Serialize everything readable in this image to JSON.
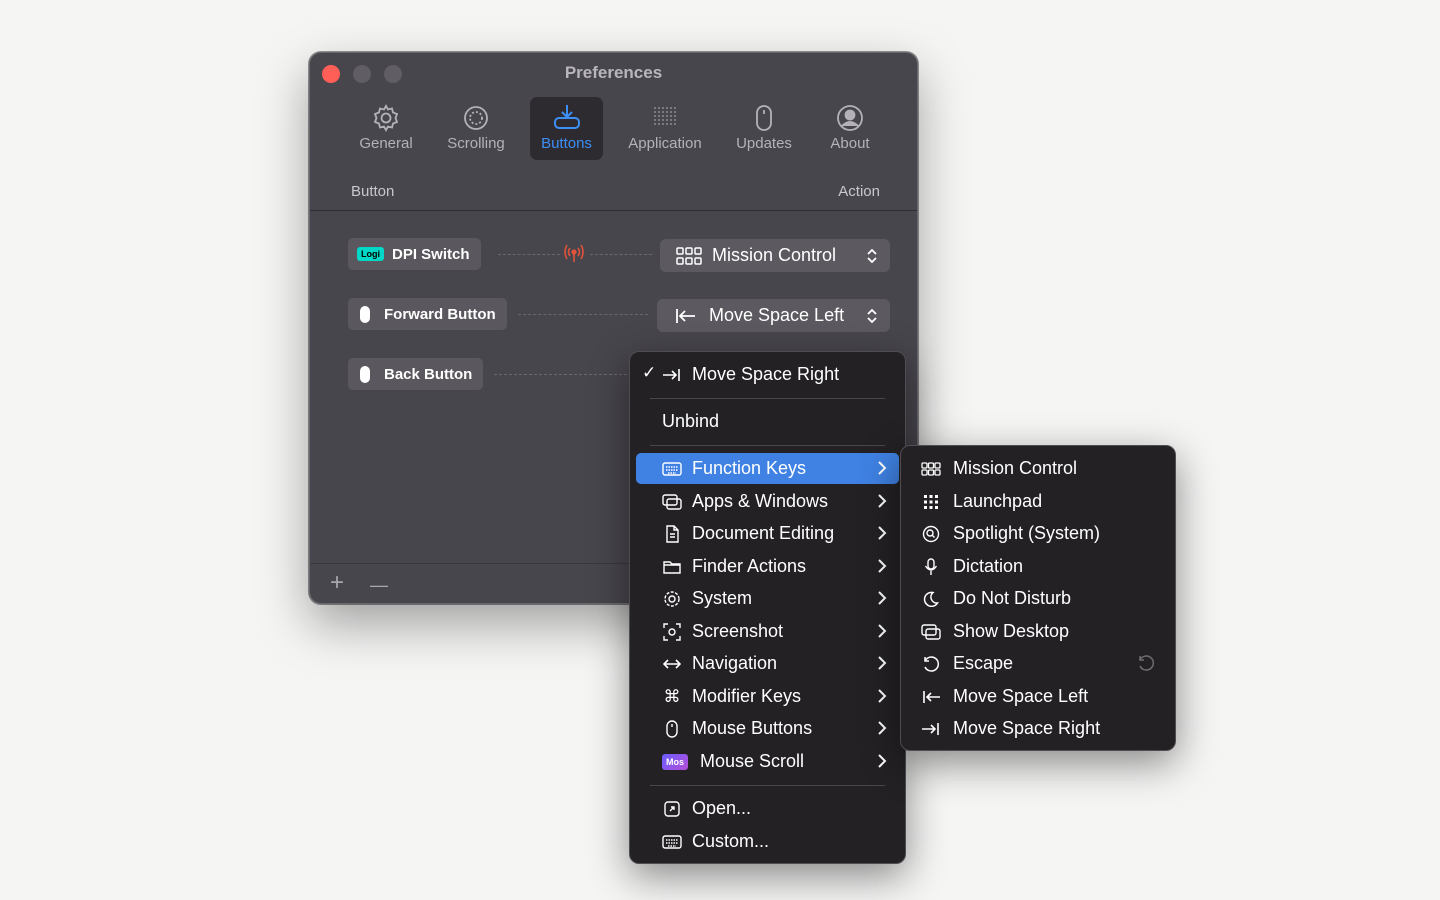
{
  "window": {
    "title": "Preferences"
  },
  "tabs": [
    {
      "label": "General",
      "icon": "gear-icon"
    },
    {
      "label": "Scrolling",
      "icon": "scroll-circle-icon"
    },
    {
      "label": "Buttons",
      "icon": "tray-download-icon",
      "active": true
    },
    {
      "label": "Application",
      "icon": "dot-grid-icon"
    },
    {
      "label": "Updates",
      "icon": "mouse-update-icon"
    },
    {
      "label": "About",
      "icon": "person-circle-icon"
    }
  ],
  "table": {
    "button_header": "Button",
    "action_header": "Action"
  },
  "rows": [
    {
      "badge": "Logi",
      "button": "DPI Switch",
      "action": "Mission Control",
      "action_icon": "grid-icon",
      "status_icon": "broadcast-icon"
    },
    {
      "button": "Forward Button",
      "action": "Move Space Left",
      "action_icon": "arrow-left-bar-icon"
    },
    {
      "button": "Back Button",
      "action": "Move Space Right"
    }
  ],
  "footer": {
    "add": "+",
    "remove": "—"
  },
  "action_menu": {
    "checked": "Move Space Right",
    "unbind": "Unbind",
    "categories": [
      {
        "label": "Function Keys",
        "icon": "keyboard-icon",
        "highlighted": true
      },
      {
        "label": "Apps & Windows",
        "icon": "windows-icon"
      },
      {
        "label": "Document Editing",
        "icon": "document-icon"
      },
      {
        "label": "Finder Actions",
        "icon": "folder-icon"
      },
      {
        "label": "System",
        "icon": "gear-icon"
      },
      {
        "label": "Screenshot",
        "icon": "screenshot-icon"
      },
      {
        "label": "Navigation",
        "icon": "left-right-arrow-icon"
      },
      {
        "label": "Modifier Keys",
        "icon": "command-icon"
      },
      {
        "label": "Mouse Buttons",
        "icon": "mouse-icon"
      },
      {
        "label": "Mouse Scroll",
        "badge": "Mos"
      }
    ],
    "open": "Open...",
    "custom": "Custom..."
  },
  "submenu": {
    "items": [
      {
        "label": "Mission Control",
        "icon": "grid-icon"
      },
      {
        "label": "Launchpad",
        "icon": "launchpad-icon"
      },
      {
        "label": "Spotlight (System)",
        "icon": "spotlight-icon"
      },
      {
        "label": "Dictation",
        "icon": "microphone-icon"
      },
      {
        "label": "Do Not Disturb",
        "icon": "moon-icon"
      },
      {
        "label": "Show Desktop",
        "icon": "desktop-windows-icon"
      },
      {
        "label": "Escape",
        "icon": "escape-icon",
        "trailing_icon": "reset-icon"
      },
      {
        "label": "Move Space Left",
        "icon": "arrow-left-bar-icon"
      },
      {
        "label": "Move Space Right",
        "icon": "arrow-right-bar-icon"
      }
    ]
  },
  "colors": {
    "accent": "#3d8ef5",
    "highlight": "#3f82e3",
    "close": "#ff5f57",
    "logi_badge": "#00d9c7",
    "signal": "#e0533a"
  }
}
